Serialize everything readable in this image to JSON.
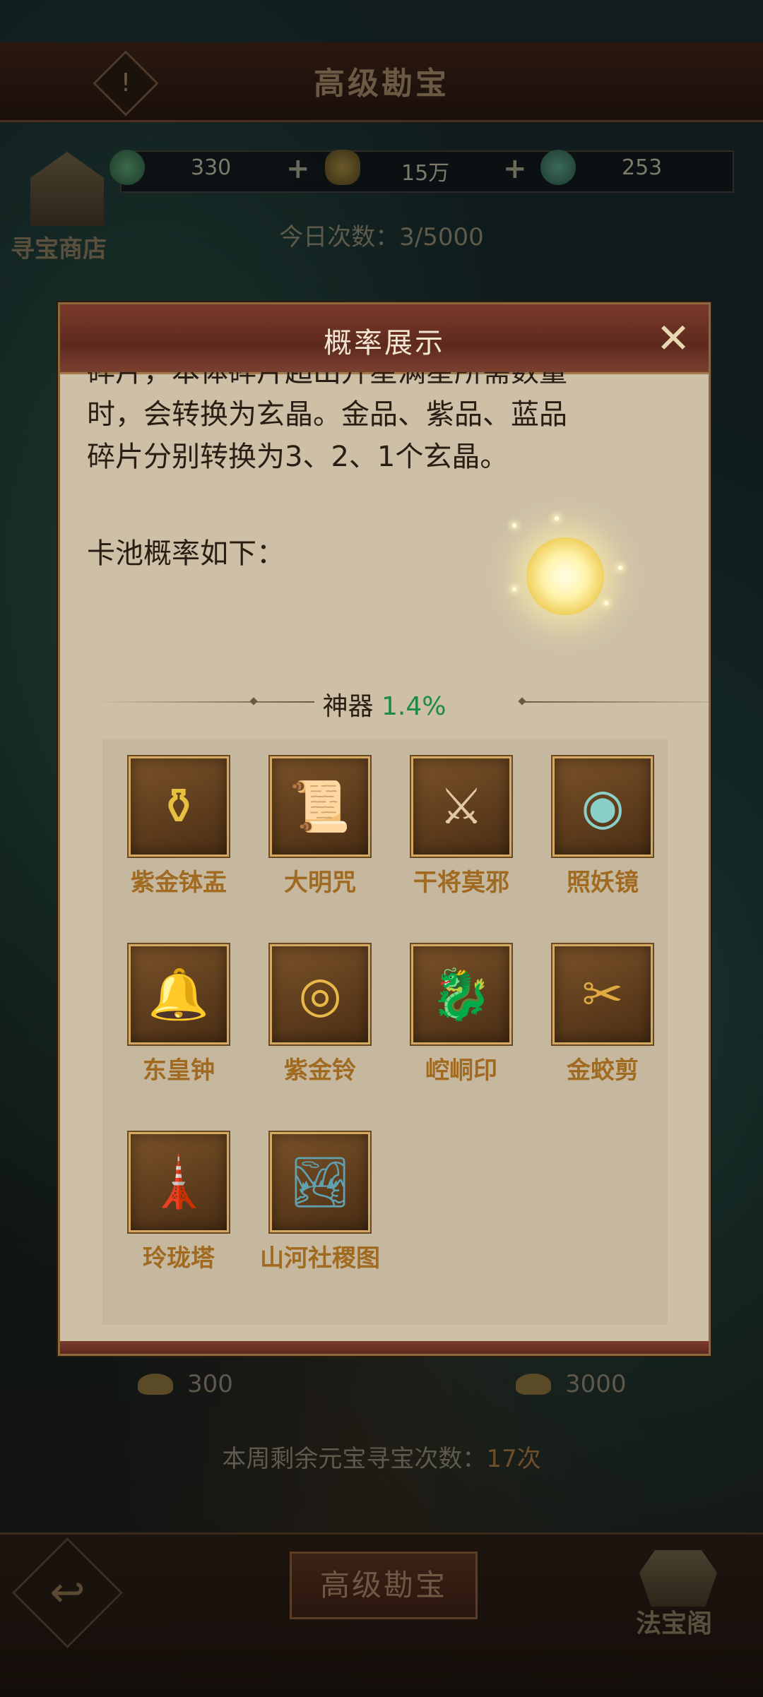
{
  "header": {
    "title": "高级勘宝",
    "warn_icon": "!"
  },
  "currencies": [
    {
      "icon": "jade-icon",
      "value": "330"
    },
    {
      "icon": "gold-ingot-icon",
      "value": "15万"
    },
    {
      "icon": "coin-icon",
      "value": "253"
    }
  ],
  "plus": "+",
  "shop": {
    "label": "寻宝商店"
  },
  "daily_count": "今日次数：3/5000",
  "modal": {
    "title": "概率展示",
    "close": "✕",
    "text_line1": "碎片，本体碎片超出升星满星所需数量",
    "text_line2": "时，会转换为玄晶。金品、紫品、蓝品",
    "text_line3": "碎片分别转换为3、2、1个玄晶。",
    "pool_label": "卡池概率如下：",
    "section": {
      "name": "神器",
      "percent": "1.4%"
    },
    "items": [
      {
        "name": "紫金钵盂",
        "icon": "golden-bowl-icon",
        "glyph": "⚱",
        "color": "#e8c040"
      },
      {
        "name": "大明咒",
        "icon": "scroll-tablet-icon",
        "glyph": "📜",
        "color": "#f0d8b0"
      },
      {
        "name": "干将莫邪",
        "icon": "crossed-swords-icon",
        "glyph": "⚔",
        "color": "#e0c8a0"
      },
      {
        "name": "照妖镜",
        "icon": "mirror-icon",
        "glyph": "◉",
        "color": "#8ad0c8"
      },
      {
        "name": "东皇钟",
        "icon": "bell-icon",
        "glyph": "🔔",
        "color": "#4ac0a8"
      },
      {
        "name": "紫金铃",
        "icon": "ring-bells-icon",
        "glyph": "◎",
        "color": "#e8b848"
      },
      {
        "name": "崆峒印",
        "icon": "dragon-seal-icon",
        "glyph": "🐉",
        "color": "#9ad080"
      },
      {
        "name": "金蛟剪",
        "icon": "golden-scissors-icon",
        "glyph": "✂",
        "color": "#e0a840"
      },
      {
        "name": "玲珑塔",
        "icon": "pagoda-icon",
        "glyph": "🗼",
        "color": "#7a9ae8"
      },
      {
        "name": "山河社稷图",
        "icon": "landscape-scroll-icon",
        "glyph": "🏞",
        "color": "#60a0b0"
      }
    ]
  },
  "bottom_costs": [
    {
      "value": "300"
    },
    {
      "value": "3000"
    }
  ],
  "weekly": {
    "label": "本周剩余元宝寻宝次数：",
    "count": "17次"
  },
  "footer": {
    "back": "↩",
    "main_button": "高级勘宝",
    "fabao_label": "法宝阁"
  }
}
